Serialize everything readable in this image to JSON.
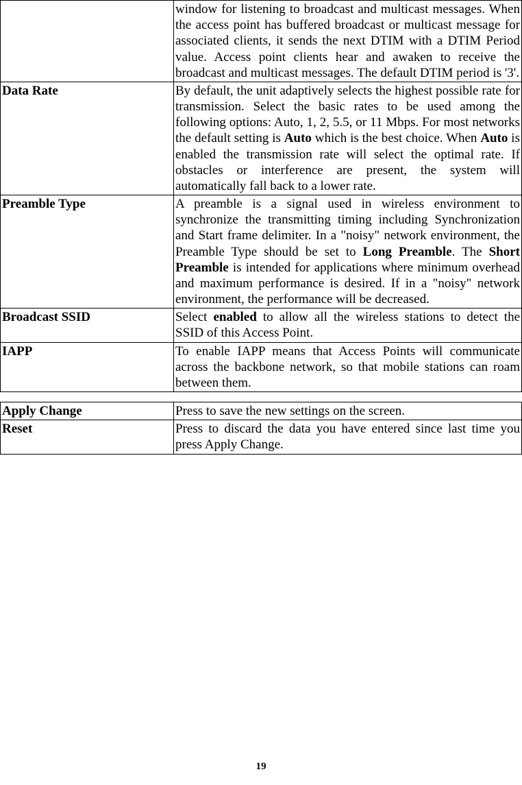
{
  "rows1": [
    {
      "label": "",
      "desc_parts": [
        {
          "t": "window for listening to broadcast and multicast messages. When the access point has buffered broadcast or multicast message for associated clients, it sends the next DTIM with a DTIM Period value. Access point clients hear and awaken to receive the broadcast and multicast messages. The default DTIM period is '3'."
        }
      ]
    },
    {
      "label": "Data Rate",
      "desc_parts": [
        {
          "t": "By default, the unit adaptively selects the highest possible rate for transmission. Select the basic rates to be used among the following options: Auto, 1, 2, 5.5, or 11 Mbps. For most networks the default setting is "
        },
        {
          "t": "Auto",
          "b": true
        },
        {
          "t": " which is the best choice. When "
        },
        {
          "t": "Auto",
          "b": true
        },
        {
          "t": " is enabled the transmission rate will select the optimal rate. If obstacles or interference are present, the system will automatically fall back to a lower rate."
        }
      ]
    },
    {
      "label": "Preamble Type",
      "desc_parts": [
        {
          "t": "A preamble is a signal used in wireless environment to synchronize the transmitting timing including Synchronization and Start frame delimiter. In a \"noisy\" network environment, the Preamble Type should be set to "
        },
        {
          "t": "Long Preamble",
          "b": true
        },
        {
          "t": ". The "
        },
        {
          "t": "Short Preamble",
          "b": true
        },
        {
          "t": " is intended for applications where minimum overhead and maximum performance is desired. If in a \"noisy\" network environment, the performance will be decreased."
        }
      ]
    },
    {
      "label": "Broadcast SSID",
      "desc_parts": [
        {
          "t": "Select "
        },
        {
          "t": "enabled",
          "b": true
        },
        {
          "t": " to allow all the wireless stations to detect the SSID of this Access Point."
        }
      ]
    },
    {
      "label": "IAPP",
      "desc_parts": [
        {
          "t": "To enable IAPP means that Access Points will communicate across the backbone network, so that mobile stations can roam between them."
        }
      ]
    }
  ],
  "rows2": [
    {
      "label": "Apply Change",
      "desc_parts": [
        {
          "t": "Press to save the new settings on the screen."
        }
      ]
    },
    {
      "label": "Reset",
      "desc_parts": [
        {
          "t": "Press to discard the data you have entered since last time you press Apply Change."
        }
      ]
    }
  ],
  "page_number": "19"
}
